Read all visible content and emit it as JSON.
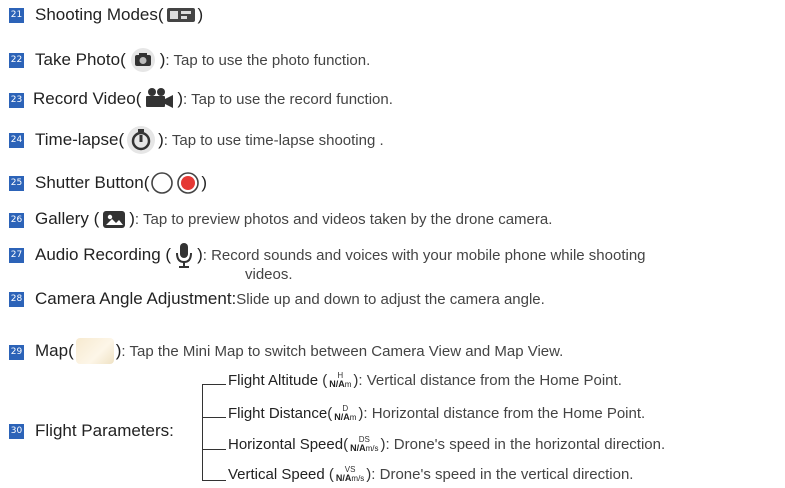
{
  "items": [
    {
      "num": "21",
      "title": "Shooting Modes",
      "desc": ""
    },
    {
      "num": "22",
      "title": "Take Photo",
      "desc": ": Tap to use the photo function."
    },
    {
      "num": "23",
      "title": "Record Video",
      "desc": ": Tap to use the record function."
    },
    {
      "num": "24",
      "title": "Time-lapse",
      "desc": ": Tap to use time-lapse shooting ."
    },
    {
      "num": "25",
      "title": "Shutter Button",
      "desc": ""
    },
    {
      "num": "26",
      "title": "Gallery",
      "desc": ":  Tap to preview photos and videos taken by the drone camera."
    },
    {
      "num": "27",
      "title": "Audio Recording",
      "desc": ": Record sounds and voices with your mobile phone while shooting",
      "desc2": "videos."
    },
    {
      "num": "28",
      "title": "Camera Angle Adjustment:",
      "desc": " Slide up and down to adjust the camera angle."
    },
    {
      "num": "29",
      "title": "Map",
      "desc": ": Tap the Mini Map to switch between Camera View and Map View."
    },
    {
      "num": "30",
      "title": "Flight Parameters:",
      "desc": ""
    }
  ],
  "params": [
    {
      "name": "Flight Altitude",
      "sup": "H",
      "val": "N/A",
      "unit": "m",
      "desc": ": Vertical distance from the Home Point."
    },
    {
      "name": "Flight Distance",
      "sup": "D",
      "val": "N/A",
      "unit": "m",
      "desc": ": Horizontal distance from the Home Point."
    },
    {
      "name": "Horizontal Speed",
      "sup": "DS",
      "val": "N/A",
      "unit": "m/s",
      "desc": ": Drone's speed in the horizontal direction."
    },
    {
      "name": "Vertical Speed",
      "sup": "VS",
      "val": "N/A",
      "unit": "m/s",
      "desc": ": Drone's speed in the vertical direction."
    }
  ],
  "icons": {
    "shooting_modes": "camera-mode-icon",
    "take_photo": "camera-icon",
    "record_video": "video-camera-icon",
    "time_lapse": "timelapse-icon",
    "shutter_idle": "shutter-ring-icon",
    "shutter_record": "record-dot-icon",
    "gallery": "image-icon",
    "audio": "microphone-icon",
    "map": "mini-map-thumbnail"
  },
  "colors": {
    "badge": "#2c63b8",
    "record": "#e53935"
  }
}
